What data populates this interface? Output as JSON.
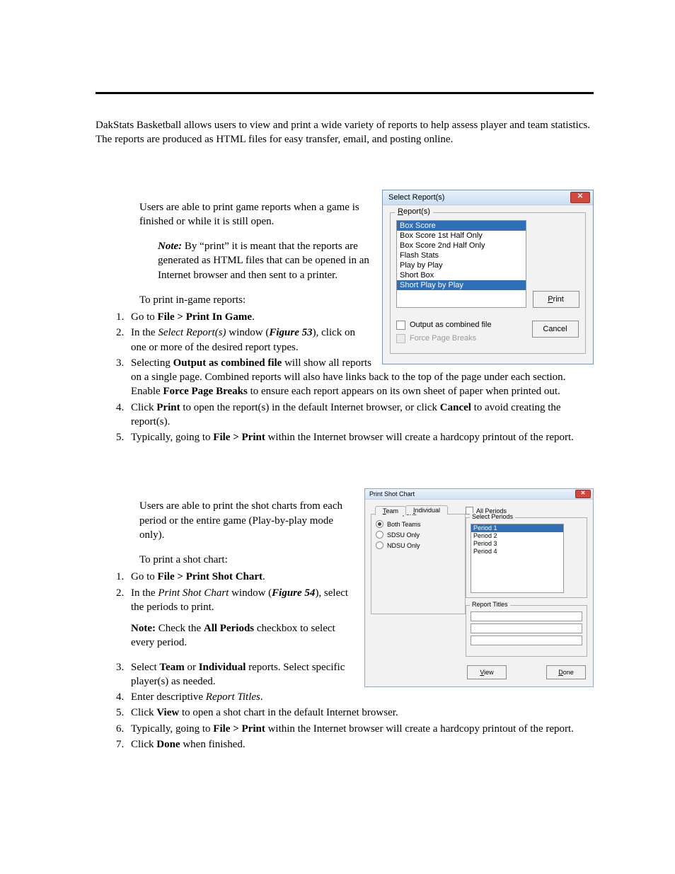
{
  "intro": "DakStats Basketball allows users to view and print a wide variety of reports to help assess player and team statistics. The reports are produced as HTML files for easy transfer, email, and posting online.",
  "section1": {
    "p1": "Users are able to print game reports when a game is finished or while it is still open.",
    "note_label": "Note:",
    "note_body": " By “print” it is meant that the reports are generated as HTML files that can be opened in an Internet browser and then sent to a printer.",
    "lead": "To print in-game reports:",
    "steps": {
      "s1_a": "Go to ",
      "s1_b": "File > Print In Game",
      "s1_c": ".",
      "s2_a": "In the ",
      "s2_b": "Select Report(s)",
      "s2_c": " window (",
      "s2_d": "Figure 53",
      "s2_e": "), click on one or more of the desired report types.",
      "s3_a": "Selecting ",
      "s3_b": "Output as combined file",
      "s3_c": " will show all reports on a single page. Combined reports will also have links back to the top of the page under each section. Enable ",
      "s3_d": "Force Page Breaks",
      "s3_e": " to ensure each report appears on its own sheet of paper when printed out.",
      "s4_a": "Click ",
      "s4_b": "Print",
      "s4_c": " to open the report(s) in the default Internet browser, or click ",
      "s4_d": "Cancel",
      "s4_e": " to avoid creating the report(s).",
      "s5_a": "Typically, going to ",
      "s5_b": "File > Print",
      "s5_c": " within the Internet browser will create a hardcopy printout of the report."
    }
  },
  "section2": {
    "p1": "Users are able to print the shot charts from each period or the entire game (Play-by-play mode only).",
    "lead": "To print a shot chart:",
    "steps": {
      "s1_a": "Go to ",
      "s1_b": "File > Print Shot Chart",
      "s1_c": ".",
      "s2_a": "In the ",
      "s2_b": "Print Shot Chart",
      "s2_c": " window (",
      "s2_d": "Figure 54",
      "s2_e": "), select the periods to print.",
      "note_label": "Note:",
      "note_body_a": " Check the ",
      "note_body_b": "All Periods",
      "note_body_c": " checkbox to select every period.",
      "s3_a": "Select ",
      "s3_b": "Team",
      "s3_c": " or ",
      "s3_d": "Individual",
      "s3_e": " reports. Select specific player(s) as needed.",
      "s4_a": "Enter descriptive ",
      "s4_b": "Report Titles",
      "s4_c": ".",
      "s5_a": "Click ",
      "s5_b": "View",
      "s5_c": " to open a shot chart in the default Internet browser.",
      "s6_a": "Typically, going to ",
      "s6_b": "File > Print",
      "s6_c": " within the Internet browser will create a hardcopy printout of the report.",
      "s7_a": "Click ",
      "s7_b": "Done",
      "s7_c": " when finished."
    }
  },
  "dlg1": {
    "title": "Select Report(s)",
    "group_prefix": "R",
    "group_rest": "eport(s)",
    "items": [
      {
        "label": "Box Score",
        "selected": true
      },
      {
        "label": "Box Score 1st Half Only",
        "selected": false
      },
      {
        "label": "Box Score 2nd Half Only",
        "selected": false
      },
      {
        "label": "Flash Stats",
        "selected": false
      },
      {
        "label": "Play by Play",
        "selected": false
      },
      {
        "label": "Short Box",
        "selected": false
      },
      {
        "label": "Short Play by Play",
        "selected": true
      }
    ],
    "print_u": "P",
    "print_rest": "rint",
    "cancel": "Cancel",
    "chk1": "Output as combined file",
    "chk2": "Force Page Breaks"
  },
  "dlg2": {
    "title": "Print Shot Chart",
    "tab1_u": "T",
    "tab1_rest": "eam",
    "tab2_u": "I",
    "tab2_rest": "ndividual",
    "team_group": "Team Reports",
    "radios": [
      {
        "label": "Both Teams",
        "checked": true
      },
      {
        "label": "SDSU Only",
        "checked": false
      },
      {
        "label": "NDSU Only",
        "checked": false
      }
    ],
    "allp_u": "A",
    "allp_rest": "ll Periods",
    "periods_group": "Select Periods",
    "periods": [
      {
        "label": "Period 1",
        "selected": true
      },
      {
        "label": "Period 2",
        "selected": false
      },
      {
        "label": "Period 3",
        "selected": false
      },
      {
        "label": "Period 4",
        "selected": false
      }
    ],
    "rt_group": "Report Titles",
    "view_u": "V",
    "view_rest": "iew",
    "done_u": "D",
    "done_rest": "one"
  }
}
